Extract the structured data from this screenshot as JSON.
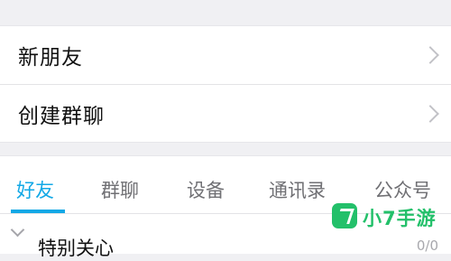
{
  "menu": {
    "items": [
      {
        "label": "新朋友"
      },
      {
        "label": "创建群聊"
      }
    ]
  },
  "tabs": {
    "items": [
      {
        "label": "好友",
        "active": true
      },
      {
        "label": "群聊",
        "active": false
      },
      {
        "label": "设备",
        "active": false
      },
      {
        "label": "通讯录",
        "active": false
      },
      {
        "label": "公众号",
        "active": false
      }
    ]
  },
  "group": {
    "label": "特别关心",
    "count": "0/0"
  },
  "watermark": {
    "text": "小7手游"
  },
  "colors": {
    "accent": "#12a8e6",
    "background": "#f0f0f3",
    "watermark": "#23c06a"
  },
  "icons": {
    "menu_chevron": "chevron-right-icon",
    "group_chevron": "chevron-down-icon",
    "watermark_logo": "seven-logo-icon"
  }
}
